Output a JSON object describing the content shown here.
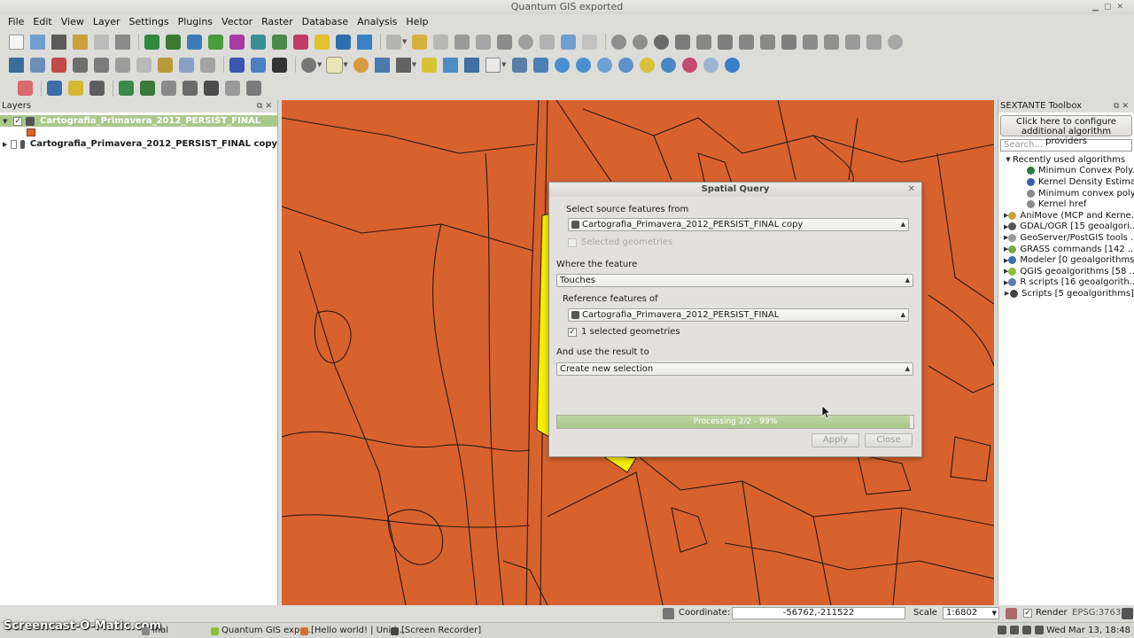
{
  "window": {
    "title": "Quantum GIS exported"
  },
  "menu": [
    "File",
    "Edit",
    "View",
    "Layer",
    "Settings",
    "Plugins",
    "Vector",
    "Raster",
    "Database",
    "Analysis",
    "Help"
  ],
  "layers_panel": {
    "title": "Layers",
    "layers": [
      {
        "name": "Cartografia_Primavera_2012_PERSIST_FINAL",
        "checked": true,
        "selected": true,
        "expanded": true,
        "swatch_color": "#d8622e"
      },
      {
        "name": "Cartografia_Primavera_2012_PERSIST_FINAL copy",
        "checked": false,
        "selected": false,
        "expanded": false
      }
    ]
  },
  "sextante": {
    "title": "SEXTANTE Toolbox",
    "configure_button": "Click here to configure additional algorithm providers",
    "search_placeholder": "Search...",
    "recent_group": "Recently used algorithms",
    "recent_items": [
      "Minimun Convex Poly...",
      "Kernel Density Estima...",
      "Minimum convex poly...",
      "Kernel href"
    ],
    "providers": [
      "AniMove (MCP and Kerne...",
      "GDAL/OGR [15 geoalgori...",
      "GeoServer/PostGIS tools ...",
      "GRASS commands [142 ...",
      "Modeler [0 geoalgorithms]",
      "QGIS geoalgorithms [58 ...",
      "R scripts [16 geoalgorith...",
      "Scripts [5 geoalgorithms]"
    ]
  },
  "dialog": {
    "title": "Spatial Query",
    "source_label": "Select source features from",
    "source_value": "Cartografia_Primavera_2012_PERSIST_FINAL copy",
    "source_selected_label": "Selected geometries",
    "where_label": "Where the feature",
    "where_value": "Touches",
    "reference_label": "Reference features of",
    "reference_value": "Cartografia_Primavera_2012_PERSIST_FINAL",
    "reference_selected_label": "1 selected geometries",
    "result_label": "And use the result to",
    "result_value": "Create new selection",
    "progress_text": "Processing 2/2 - 99%",
    "progress_fraction": 0.99,
    "apply_label": "Apply",
    "close_label": "Close"
  },
  "status": {
    "coordinate_label": "Coordinate:",
    "coordinate_value": "-56762,-211522",
    "scale_label": "Scale",
    "scale_value": "1:6802",
    "render_label": "Render",
    "epsg": "EPSG:3763"
  },
  "taskbar": {
    "watermark": "Screencast-O-Matic.com",
    "tasks": [
      "inal",
      "Quantum GIS expo...",
      "[Hello world! | Unid...",
      "[Screen Recorder]"
    ],
    "clock": "Wed Mar 13, 18:48"
  },
  "colors": {
    "map_fill": "#d8622e",
    "selection": "#ffff00",
    "layer_selected": "#a9c98c",
    "progress": "#a7c78a"
  }
}
